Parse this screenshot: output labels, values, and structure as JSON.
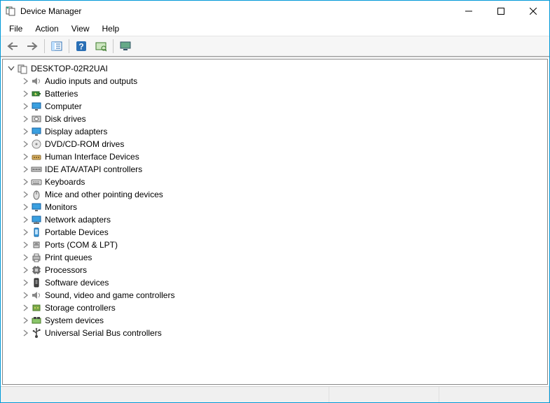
{
  "window": {
    "title": "Device Manager"
  },
  "menu": {
    "items": [
      "File",
      "Action",
      "View",
      "Help"
    ]
  },
  "toolbar": {
    "buttons": [
      {
        "name": "back",
        "icon": "arrow-left"
      },
      {
        "name": "forward",
        "icon": "arrow-right"
      },
      {
        "sep": true
      },
      {
        "name": "show-hide-tree",
        "icon": "tree-pane"
      },
      {
        "sep": true
      },
      {
        "name": "help",
        "icon": "help"
      },
      {
        "name": "scan-hardware",
        "icon": "scan"
      },
      {
        "sep": true
      },
      {
        "name": "devices-printers",
        "icon": "monitor-green"
      }
    ]
  },
  "tree": {
    "root": {
      "label": "DESKTOP-02R2UAI",
      "icon": "computer",
      "expanded": true
    },
    "categories": [
      {
        "label": "Audio inputs and outputs",
        "icon": "audio"
      },
      {
        "label": "Batteries",
        "icon": "battery"
      },
      {
        "label": "Computer",
        "icon": "monitor"
      },
      {
        "label": "Disk drives",
        "icon": "disk"
      },
      {
        "label": "Display adapters",
        "icon": "monitor"
      },
      {
        "label": "DVD/CD-ROM drives",
        "icon": "optical"
      },
      {
        "label": "Human Interface Devices",
        "icon": "hid"
      },
      {
        "label": "IDE ATA/ATAPI controllers",
        "icon": "ide"
      },
      {
        "label": "Keyboards",
        "icon": "keyboard"
      },
      {
        "label": "Mice and other pointing devices",
        "icon": "mouse"
      },
      {
        "label": "Monitors",
        "icon": "monitor"
      },
      {
        "label": "Network adapters",
        "icon": "network"
      },
      {
        "label": "Portable Devices",
        "icon": "portable"
      },
      {
        "label": "Ports (COM & LPT)",
        "icon": "port"
      },
      {
        "label": "Print queues",
        "icon": "printer"
      },
      {
        "label": "Processors",
        "icon": "cpu"
      },
      {
        "label": "Software devices",
        "icon": "software"
      },
      {
        "label": "Sound, video and game controllers",
        "icon": "audio"
      },
      {
        "label": "Storage controllers",
        "icon": "storage"
      },
      {
        "label": "System devices",
        "icon": "system"
      },
      {
        "label": "Universal Serial Bus controllers",
        "icon": "usb"
      }
    ]
  }
}
